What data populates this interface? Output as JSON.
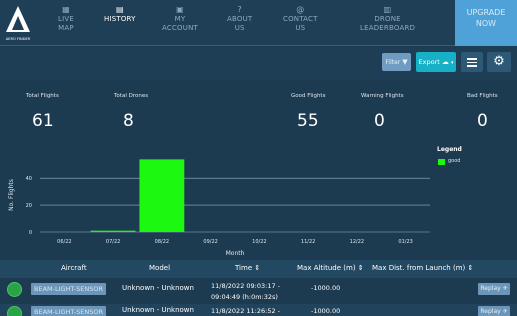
{
  "brand": {
    "logo_text": "AERO FINDER"
  },
  "nav": {
    "items": [
      {
        "icon": "map-icon",
        "label": "LIVE MAP",
        "line1": "LIVE",
        "line2": "MAP"
      },
      {
        "icon": "history-icon",
        "label": "HISTORY"
      },
      {
        "icon": "account-icon",
        "label": "MY ACCOUNT",
        "line1": "MY",
        "line2": "ACCOUNT"
      },
      {
        "icon": "question-icon",
        "label": "ABOUT US",
        "line1": "ABOUT",
        "line2": "US"
      },
      {
        "icon": "contact-icon",
        "label": "CONTACT US",
        "line1": "CONTACT",
        "line2": "US"
      },
      {
        "icon": "leaderboard-icon",
        "label": "DRONE LEADERBOARD",
        "line1": "DRONE",
        "line2": "LEADERBOARD"
      }
    ],
    "upgrade": {
      "line1": "UPGRADE",
      "line2": "NOW"
    }
  },
  "toolbar": {
    "filter_label": "Filter",
    "export_label": "Export"
  },
  "stats": [
    {
      "label": "Total Flights",
      "value": "61"
    },
    {
      "label": "Total Drones",
      "value": "8"
    },
    {
      "label": "Good Flights",
      "value": "55"
    },
    {
      "label": "Warning Flights",
      "value": "0"
    },
    {
      "label": "Bad Flights",
      "value": "0"
    }
  ],
  "chart_data": {
    "type": "bar",
    "categories": [
      "06/22",
      "07/22",
      "08/22",
      "09/22",
      "10/22",
      "11/22",
      "12/22",
      "01/23"
    ],
    "series": [
      {
        "name": "good",
        "values": [
          0,
          1,
          54,
          0,
          0,
          0,
          0,
          0
        ],
        "color": "#1cf80f"
      }
    ],
    "xlabel": "Month",
    "ylabel": "No. Flights",
    "yticks": [
      0,
      20,
      40
    ],
    "ylim": [
      0,
      55
    ],
    "grid": true,
    "legend": {
      "title": "Legend",
      "position": "right"
    }
  },
  "table": {
    "headers": [
      "Aircraft",
      "Model",
      "Time",
      "Max Altitude (m)",
      "Max Dist. from Launch (m)"
    ],
    "sort_indicator": "⇕",
    "rows": [
      {
        "aircraft": "BEAM-LIGHT-SENSOR",
        "model": "Unknown - Unknown",
        "time_line1": "11/8/2022 09:03:17 -",
        "time_line2": "09:04:49 (h:0m:32s)",
        "altitude": "-1000.00",
        "replay": "Replay"
      },
      {
        "aircraft": "BEAM-LIGHT-SENSOR",
        "model": "Unknown - Unknown",
        "time_line1": "11/8/2022 11:26:52 -",
        "altitude": "-1000.00",
        "replay": "Replay"
      }
    ]
  }
}
